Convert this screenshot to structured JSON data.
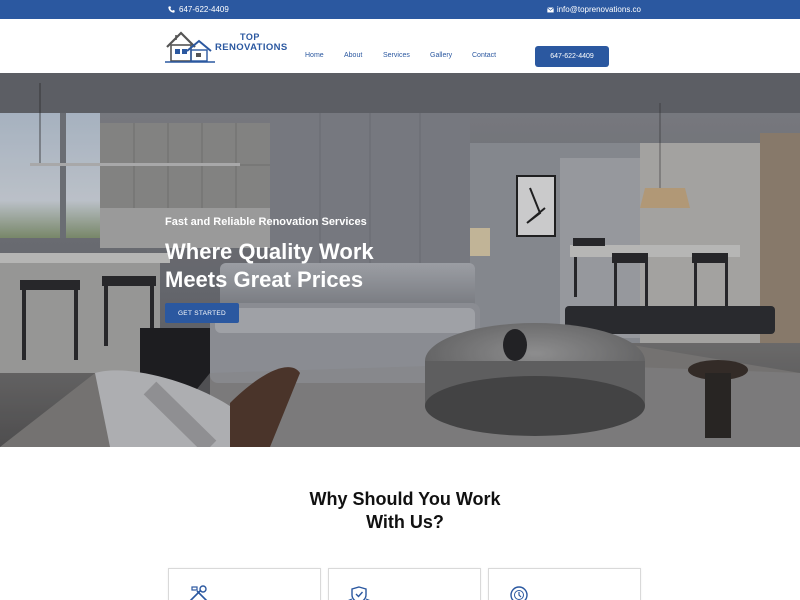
{
  "topbar": {
    "phone": "647-622-4409",
    "email": "info@toprenovations.co",
    "phone_icon": "phone-icon",
    "email_icon": "envelope-icon"
  },
  "logo": {
    "line1": "TOP",
    "line2": "RENOVATIONS",
    "icon": "house-logo-icon"
  },
  "nav": {
    "items": [
      "Home",
      "About",
      "Services",
      "Gallery",
      "Contact"
    ]
  },
  "header_button": "647-622-4409",
  "hero": {
    "tagline": "Fast and Reliable Renovation Services",
    "title_line1": "Where Quality Work",
    "title_line2": "Meets Great Prices",
    "button": "GET STARTED"
  },
  "why": {
    "title_line1": "Why Should You Work",
    "title_line2": "With Us?",
    "cards": [
      {
        "icon": "tools-icon"
      },
      {
        "icon": "shield-badge-icon"
      },
      {
        "icon": "clock-dollar-icon"
      }
    ]
  },
  "colors": {
    "brand": "#2b58a0",
    "text_dark": "#111111",
    "white": "#ffffff"
  }
}
